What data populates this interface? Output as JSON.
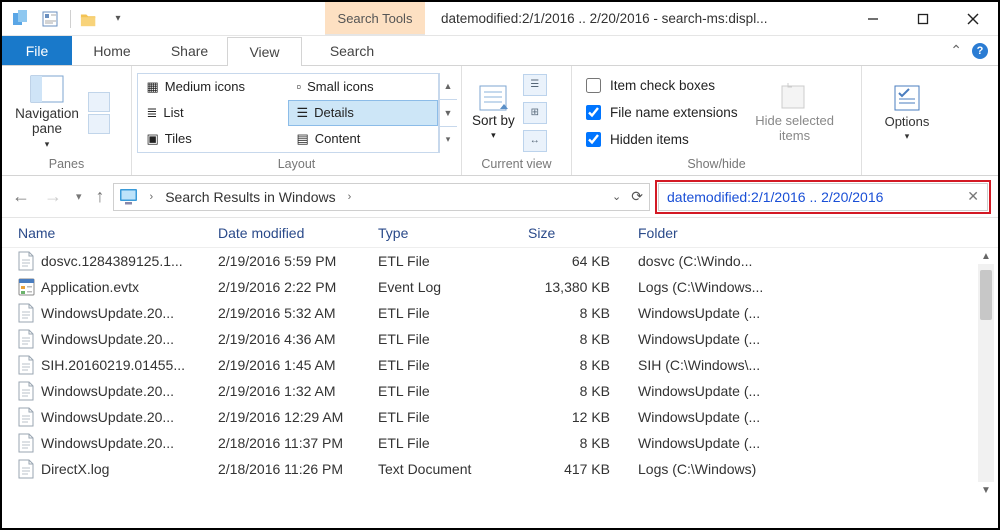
{
  "titlebar": {
    "tool_tab": "Search Tools",
    "title": "datemodified:2/1/2016 .. 2/20/2016 - search-ms:displ..."
  },
  "tabs": {
    "file": "File",
    "home": "Home",
    "share": "Share",
    "view": "View",
    "search": "Search"
  },
  "ribbon": {
    "panes_label": "Panes",
    "nav_pane": "Navigation pane",
    "layout": {
      "medium": "Medium icons",
      "small": "Small icons",
      "list": "List",
      "details": "Details",
      "tiles": "Tiles",
      "content": "Content",
      "label": "Layout"
    },
    "current_view": {
      "sort": "Sort by",
      "label": "Current view"
    },
    "showhide": {
      "check_boxes": "Item check boxes",
      "extensions": "File name extensions",
      "hidden": "Hidden items",
      "hide_selected": "Hide selected items",
      "label": "Show/hide"
    },
    "options": "Options"
  },
  "address": {
    "crumb1": "Search Results in Windows"
  },
  "search": {
    "query": "datemodified:2/1/2016 .. 2/20/2016"
  },
  "columns": {
    "name": "Name",
    "date": "Date modified",
    "type": "Type",
    "size": "Size",
    "folder": "Folder"
  },
  "files": [
    {
      "icon": "file",
      "name": "dosvc.1284389125.1...",
      "date": "2/19/2016 5:59 PM",
      "type": "ETL File",
      "size": "64 KB",
      "folder": "dosvc (C:\\Windo..."
    },
    {
      "icon": "evtx",
      "name": "Application.evtx",
      "date": "2/19/2016 2:22 PM",
      "type": "Event Log",
      "size": "13,380 KB",
      "folder": "Logs (C:\\Windows..."
    },
    {
      "icon": "file",
      "name": "WindowsUpdate.20...",
      "date": "2/19/2016 5:32 AM",
      "type": "ETL File",
      "size": "8 KB",
      "folder": "WindowsUpdate (..."
    },
    {
      "icon": "file",
      "name": "WindowsUpdate.20...",
      "date": "2/19/2016 4:36 AM",
      "type": "ETL File",
      "size": "8 KB",
      "folder": "WindowsUpdate (..."
    },
    {
      "icon": "file",
      "name": "SIH.20160219.01455...",
      "date": "2/19/2016 1:45 AM",
      "type": "ETL File",
      "size": "8 KB",
      "folder": "SIH (C:\\Windows\\..."
    },
    {
      "icon": "file",
      "name": "WindowsUpdate.20...",
      "date": "2/19/2016 1:32 AM",
      "type": "ETL File",
      "size": "8 KB",
      "folder": "WindowsUpdate (..."
    },
    {
      "icon": "file",
      "name": "WindowsUpdate.20...",
      "date": "2/19/2016 12:29 AM",
      "type": "ETL File",
      "size": "12 KB",
      "folder": "WindowsUpdate (..."
    },
    {
      "icon": "file",
      "name": "WindowsUpdate.20...",
      "date": "2/18/2016 11:37 PM",
      "type": "ETL File",
      "size": "8 KB",
      "folder": "WindowsUpdate (..."
    },
    {
      "icon": "file",
      "name": "DirectX.log",
      "date": "2/18/2016 11:26 PM",
      "type": "Text Document",
      "size": "417 KB",
      "folder": "Logs (C:\\Windows)"
    }
  ]
}
